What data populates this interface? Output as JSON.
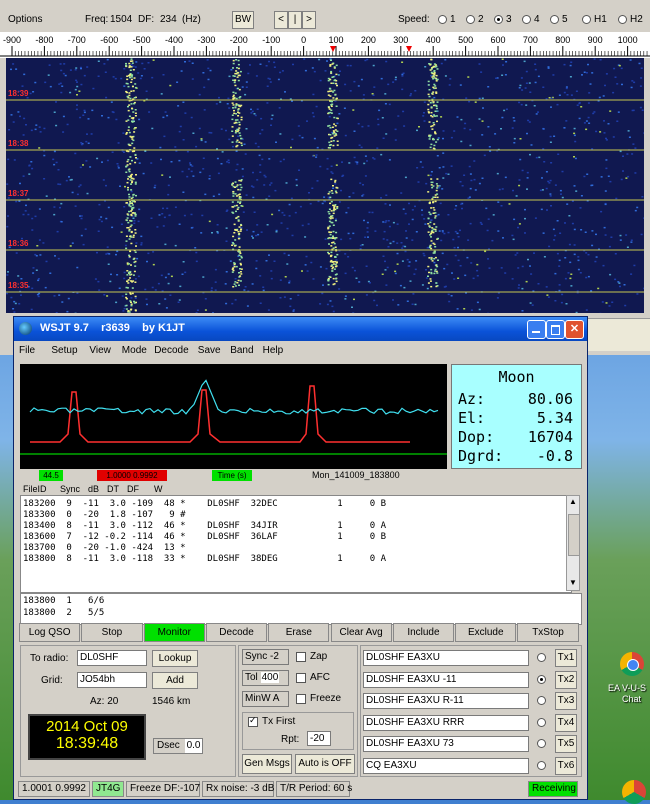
{
  "spectrum": {
    "options_label": "Options",
    "freq_label": "Freq:",
    "freq_value": "1504",
    "df_label": "DF:",
    "df_value": "234",
    "df_unit": "(Hz)",
    "bw_label": "BW",
    "nav_buttons": [
      "<",
      "|",
      ">"
    ],
    "speed_label": "Speed:",
    "speed_options": [
      "1",
      "2",
      "3",
      "4",
      "5",
      "H1",
      "H2"
    ],
    "speed_selected": "3",
    "ruler_ticks": [
      "-900",
      "-800",
      "-700",
      "-600",
      "-500",
      "-400",
      "-300",
      "-200",
      "-100",
      "0",
      "100",
      "200",
      "300",
      "400",
      "500",
      "600",
      "700",
      "800",
      "900",
      "1000"
    ],
    "time_markers": [
      "18:39",
      "18:38",
      "18:37",
      "18:36",
      "18:35"
    ]
  },
  "window": {
    "title": "WSJT 9.7    r3639    by K1JT",
    "menu": [
      "File",
      "Setup",
      "View",
      "Mode",
      "Decode",
      "Save",
      "Band",
      "Help"
    ]
  },
  "moon": {
    "title": "Moon",
    "rows": [
      {
        "label": "Az:",
        "value": "80.06"
      },
      {
        "label": "El:",
        "value": "5.34"
      },
      {
        "label": "Dop:",
        "value": "16704"
      },
      {
        "label": "Dgrd:",
        "value": "-0.8"
      }
    ]
  },
  "indicators": {
    "green_value": "44.5",
    "red_value": "1.0000  0.9992",
    "time_label": "Time (s)",
    "filename": "Mon_141009_183800"
  },
  "decode": {
    "headers": [
      "FileID",
      "Sync",
      "dB",
      "DT",
      "DF",
      "W"
    ],
    "rows": [
      "183200  9  -11  3.0 -109  48 *    DL0SHF  32DEC           1     0 B",
      "183300  0  -20  1.8 -107   9 #",
      "183400  8  -11  3.0 -112  46 *    DL0SHF  34JIR           1     0 A",
      "183600  7  -12 -0.2 -114  46 *    DL0SHF  36LAF           1     0 B",
      "183700  0  -20 -1.0 -424  13 *",
      "183800  8  -11  3.0 -118  33 *    DL0SHF  38DEG           1     0 A"
    ],
    "avg_rows": [
      "183800  1   6/6",
      "183800  2   5/5"
    ]
  },
  "buttons": [
    "Log QSO",
    "Stop",
    "Monitor",
    "Decode",
    "Erase",
    "Clear Avg",
    "Include",
    "Exclude",
    "TxStop"
  ],
  "station": {
    "to_radio_label": "To radio:",
    "to_radio_value": "DL0SHF",
    "lookup_label": "Lookup",
    "grid_label": "Grid:",
    "grid_value": "JO54bh",
    "add_label": "Add",
    "az_text": "Az: 20",
    "distance_text": "1546 km",
    "date": "2014 Oct 09",
    "time": "18:39:48",
    "dsec_label": "Dsec",
    "dsec_value": "0.0"
  },
  "controls": {
    "sync_label": "Sync",
    "sync_value": "-2",
    "zap_label": "Zap",
    "tol_label": "Tol",
    "tol_value": "400",
    "afc_label": "AFC",
    "minw_label": "MinW",
    "minw_value": "A",
    "freeze_label": "Freeze",
    "txfirst_label": "Tx First",
    "rpt_label": "Rpt:",
    "rpt_value": "-20",
    "genmsgs_label": "Gen Msgs",
    "auto_label": "Auto is OFF"
  },
  "tx_messages": [
    {
      "text": "DL0SHF EA3XU",
      "button": "Tx1",
      "selected": false
    },
    {
      "text": "DL0SHF EA3XU -11",
      "button": "Tx2",
      "selected": true
    },
    {
      "text": "DL0SHF EA3XU R-11",
      "button": "Tx3",
      "selected": false
    },
    {
      "text": "DL0SHF EA3XU RRR",
      "button": "Tx4",
      "selected": false
    },
    {
      "text": "DL0SHF EA3XU 73",
      "button": "Tx5",
      "selected": false
    },
    {
      "text": "CQ EA3XU",
      "button": "Tx6",
      "selected": false
    }
  ],
  "status": {
    "cells": [
      "1.0001  0.9992",
      "JT4G",
      "Freeze DF:-107",
      "Rx noise: -3 dB",
      "T/R Period: 60 s"
    ],
    "receiving": "Receiving"
  },
  "desktop": {
    "icon_label_1": "EA V-U-S",
    "icon_label_2": "Chat"
  },
  "colors": {
    "moon_bg": "#a8ffff",
    "monitor_green": "#00e000",
    "clock_bg": "#000000",
    "clock_text": "#ffff00",
    "receiving_green": "#00e000"
  }
}
